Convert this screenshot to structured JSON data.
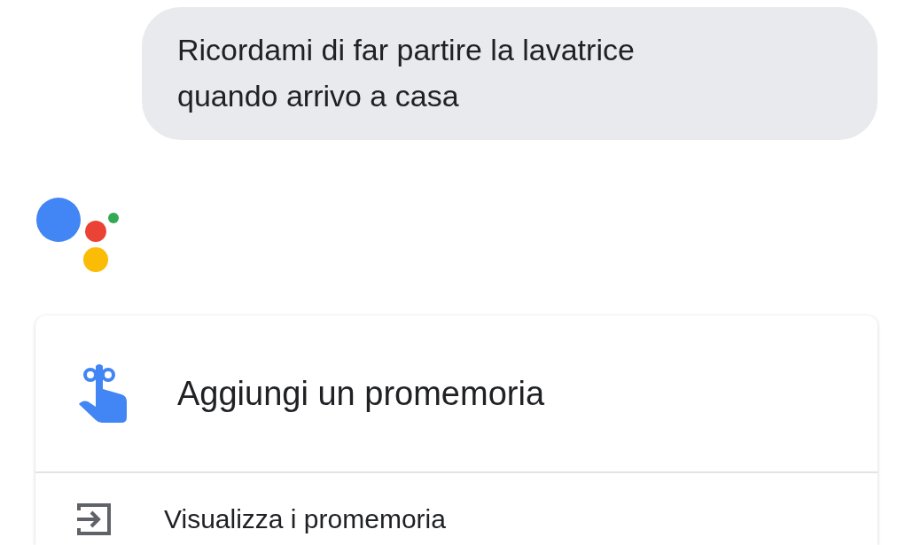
{
  "user_message": {
    "lines": [
      "Ricordami di far partire la lavatrice",
      "quando arrivo a casa"
    ]
  },
  "card": {
    "items": [
      {
        "kind": "primary",
        "label": "Aggiungi un promemoria"
      },
      {
        "kind": "secondary",
        "label": "Visualizza i promemoria"
      }
    ]
  }
}
